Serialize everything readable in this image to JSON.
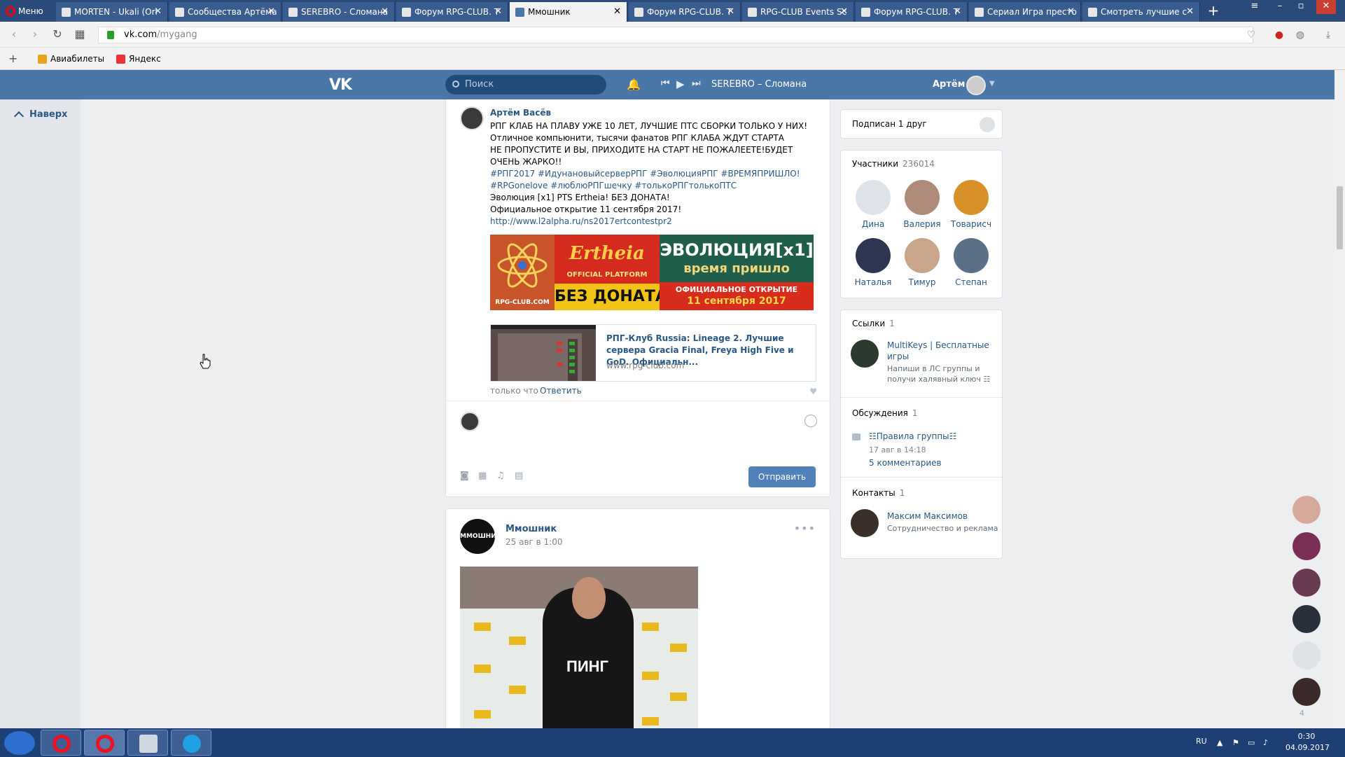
{
  "browser": {
    "menu_label": "Меню",
    "tabs": [
      {
        "title": "MORTEN - Ukali (Ori",
        "active": false
      },
      {
        "title": "Сообщества Артёма",
        "active": false
      },
      {
        "title": "SEREBRO - Сломана",
        "active": false
      },
      {
        "title": "Форум RPG-CLUB. T",
        "active": false
      },
      {
        "title": "Ммошник",
        "active": true
      },
      {
        "title": "Форум RPG-CLUB. T",
        "active": false
      },
      {
        "title": "RPG-CLUB Events Sc",
        "active": false
      },
      {
        "title": "Форум RPG-CLUB. T",
        "active": false
      },
      {
        "title": "Сериал Игра престо",
        "active": false
      },
      {
        "title": "Смотреть лучшие с",
        "active": false
      }
    ],
    "url_host": "vk.com",
    "url_path": "/mygang",
    "bookmarks": [
      "Авиабилеты",
      "Яндекс"
    ]
  },
  "vk": {
    "logo": "VK",
    "search_placeholder": "Поиск",
    "now_playing": "SEREBRO – Сломана",
    "user_name": "Артём",
    "back_to_top": "Наверх"
  },
  "wall_post": {
    "author": "Артём Васёв",
    "lines": [
      "РПГ КЛАБ НА ПЛАВУ УЖЕ 10 ЛЕТ, ЛУЧШИЕ ПТС СБОРКИ ТОЛЬКО У НИХ!",
      "Отличное компьюнити, тысячи фанатов РПГ КЛАБА ЖДУТ СТАРТА",
      "НЕ ПРОПУСТИТЕ И ВЫ, ПРИХОДИТЕ НА СТАРТ НЕ ПОЖАЛЕЕТЕ!БУДЕТ",
      "ОЧЕНЬ ЖАРКО!!"
    ],
    "hashtags_1": "#РПГ2017 #ИдунановыйсерверРПГ #ЭволюцияРПГ #ВРЕМЯПРИШЛО!",
    "hashtags_2": "#RPGonelove #люблюРПГшечку #толькоРПГтолькоПТС",
    "line_evolution": "Эволюция [x1] PTS Ertheia! БЕЗ ДОНАТА!",
    "line_opening": "Официальное открытие 11 сентября 2017!",
    "link": "http://www.l2alpha.ru/ns2017ertcontestpr2",
    "banner": {
      "site": "RPG-CLUB.COM",
      "game": "Ertheia",
      "platform": "OFFICIAL PLATFORM",
      "no_donate": "БЕЗ ДОНАТА",
      "evolution": "ЭВОЛЮЦИЯ[x1]",
      "time_came": "время пришло",
      "official_opening": "ОФИЦИАЛЬНОЕ ОТКРЫТИЕ",
      "date": "11 сентября 2017"
    },
    "snippet_title": "РПГ-Клуб Russia: Lineage 2. Лучшие сервера Gracia Final, Freya High Five и GoD. Официальн...",
    "snippet_url": "www.rpg-club.com",
    "time": "только что",
    "reply": "Ответить",
    "send": "Отправить"
  },
  "post2": {
    "group_ava_text": "ММОШНИК",
    "group_name": "Ммошник",
    "date": "25 авг в 1:00",
    "photo_caption": "ПИНГ"
  },
  "sidebar": {
    "subscribed": "Подписан 1 друг",
    "members_title": "Участники",
    "members_count": "236014",
    "members": [
      "Дина",
      "Валерия",
      "Товарисч",
      "Наталья",
      "Тимур",
      "Степан"
    ],
    "links_title": "Ссылки",
    "links_count": "1",
    "link_name": "MultiKeys | Бесплатные игры",
    "link_desc": "Напиши в ЛС группы и получи халявный ключ ☷",
    "discussions_title": "Обсуждения",
    "discussions_count": "1",
    "discussion_name": "☷Правила группы☷",
    "discussion_date": "17 авг в 14:18",
    "discussion_comments": "5 комментариев",
    "contacts_title": "Контакты",
    "contacts_count": "1",
    "contact_name": "Максим Максимов",
    "contact_role": "Сотрудничество и реклама"
  },
  "chats": {
    "count": "4"
  },
  "taskbar": {
    "lang": "RU",
    "time": "0:30",
    "date": "04.09.2017"
  }
}
